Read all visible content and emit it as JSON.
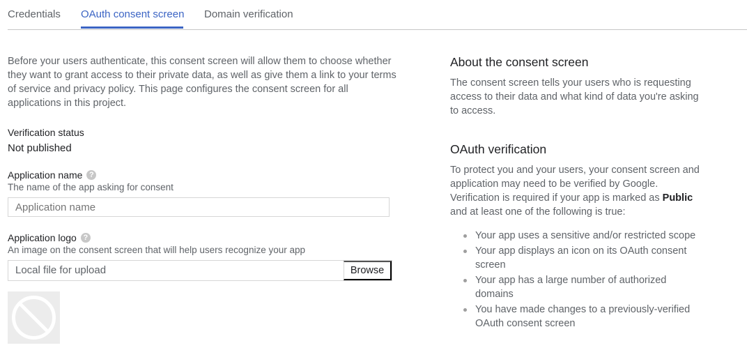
{
  "tabs": [
    {
      "label": "Credentials",
      "active": false
    },
    {
      "label": "OAuth consent screen",
      "active": true
    },
    {
      "label": "Domain verification",
      "active": false
    }
  ],
  "intro": "Before your users authenticate, this consent screen will allow them to choose whether they want to grant access to their private data, as well as give them a link to your terms of service and privacy policy. This page configures the consent screen for all applications in this project.",
  "verification": {
    "label": "Verification status",
    "value": "Not published"
  },
  "app_name": {
    "label": "Application name",
    "hint": "The name of the app asking for consent",
    "placeholder": "Application name",
    "value": ""
  },
  "app_logo": {
    "label": "Application logo",
    "hint": "An image on the consent screen that will help users recognize your app",
    "file_placeholder": "Local file for upload",
    "browse_label": "Browse"
  },
  "about": {
    "title": "About the consent screen",
    "text": "The consent screen tells your users who is requesting access to their data and what kind of data you're asking to access."
  },
  "oauth_verification": {
    "title": "OAuth verification",
    "text_before": "To protect you and your users, your consent screen and application may need to be verified by Google. Verification is required if your app is marked as",
    "text_bold": "Public",
    "text_after": "and at least one of the following is true:",
    "bullets": [
      "Your app uses a sensitive and/or restricted scope",
      "Your app displays an icon on its OAuth consent screen",
      "Your app has a large number of authorized domains",
      "You have made changes to a previously-verified OAuth consent screen"
    ]
  },
  "colors": {
    "accent": "#3b64c4",
    "muted_text": "#5f6368",
    "border": "#d6d6d6"
  }
}
